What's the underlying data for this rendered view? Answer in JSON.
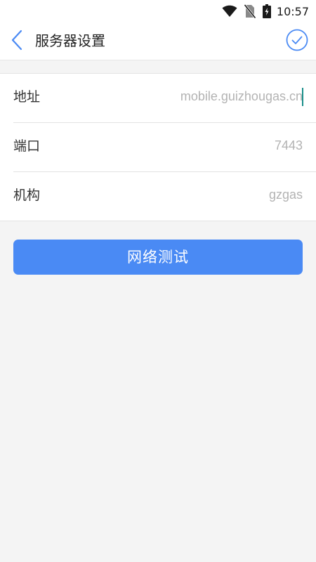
{
  "status_bar": {
    "time": "10:57",
    "icons": [
      "wifi-icon",
      "no-sim-icon",
      "battery-icon"
    ]
  },
  "app_bar": {
    "title": "服务器设置",
    "back_icon": "chevron-left-icon",
    "confirm_icon": "check-circle-icon"
  },
  "form": {
    "fields": [
      {
        "label": "地址",
        "value": "mobile.guizhougas.cn"
      },
      {
        "label": "端口",
        "value": "7443"
      },
      {
        "label": "机构",
        "value": "gzgas"
      }
    ]
  },
  "actions": {
    "network_test_label": "网络测试"
  },
  "colors": {
    "accent": "#4a8af4",
    "icon_blue": "#4a8af4",
    "background": "#f4f4f4",
    "cursor": "#1a8f8a"
  }
}
